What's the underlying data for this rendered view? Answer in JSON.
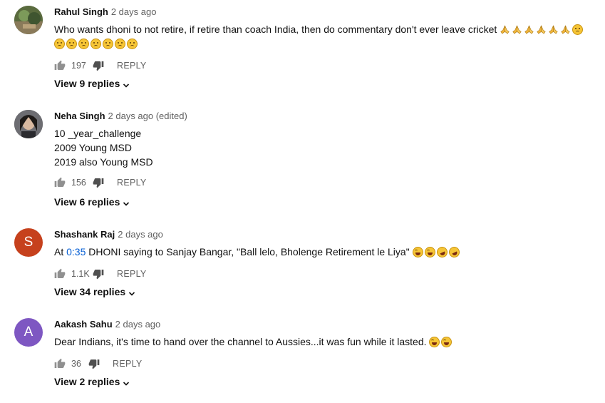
{
  "comments": [
    {
      "author": "Rahul Singh",
      "date": "2 days ago",
      "lines": [
        "Who wants dhoni to not retire, if retire than coach India, then do commentary don't ever leave cricket"
      ],
      "likes": "197",
      "reply_label": "REPLY",
      "view_replies": "View 9 replies",
      "emojis_line1": [
        "folded-hands",
        "folded-hands",
        "folded-hands",
        "folded-hands",
        "folded-hands",
        "folded-hands",
        "confused-face"
      ],
      "emojis_line2": [
        "confused-face",
        "confused-face",
        "confused-face",
        "confused-face",
        "confused-face",
        "confused-face",
        "confused-face"
      ]
    },
    {
      "author": "Neha Singh",
      "date": "2 days ago (edited)",
      "lines": [
        "10 _year_challenge",
        "2009 Young MSD",
        "2019 also Young MSD"
      ],
      "likes": "156",
      "reply_label": "REPLY",
      "view_replies": "View 6 replies"
    },
    {
      "author": "Shashank Raj",
      "date": "2 days ago",
      "avatar_letter": "S",
      "avatar_color": "#c6411d",
      "text_prefix": "At ",
      "timestamp": "0:35",
      "text_suffix": " DHONI saying to Sanjay Bangar, \"Ball lelo, Bholenge Retirement le Liya\"",
      "emojis": [
        "tears-of-joy",
        "tears-of-joy",
        "rolling-laughing",
        "rolling-laughing"
      ],
      "likes": "1.1K",
      "reply_label": "REPLY",
      "view_replies": "View 34 replies"
    },
    {
      "author": "Aakash Sahu",
      "date": "2 days ago",
      "avatar_letter": "A",
      "avatar_color": "#7e57c2",
      "text": "Dear Indians, it's time to hand over the channel to Aussies...it was fun while it lasted.",
      "emojis": [
        "tears-of-joy",
        "tears-of-joy"
      ],
      "likes": "36",
      "reply_label": "REPLY",
      "view_replies": "View 2 replies"
    }
  ],
  "icons": {
    "like": "thumb-up-icon",
    "dislike": "thumb-down-icon",
    "expand": "chevron-down-icon"
  }
}
